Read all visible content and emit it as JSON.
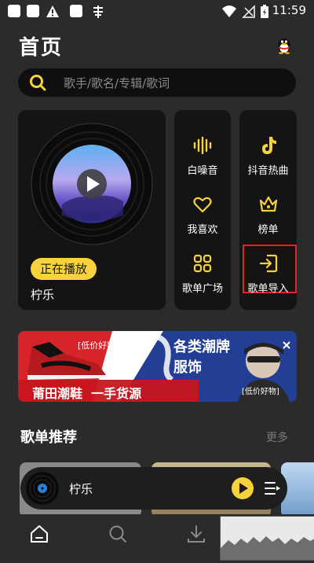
{
  "status_bar": {
    "time": "11:59"
  },
  "header": {
    "title": "首页",
    "avatar_icon": "qq-penguin-icon"
  },
  "search": {
    "placeholder": "歌手/歌名/专辑/歌词",
    "icon": "search-icon"
  },
  "now_playing": {
    "badge": "正在播放",
    "song": "柠乐"
  },
  "quick_tiles": [
    {
      "label": "白噪音",
      "icon": "soundwave-icon"
    },
    {
      "label": "抖音热曲",
      "icon": "tiktok-icon"
    },
    {
      "label": "我喜欢",
      "icon": "heart-icon"
    },
    {
      "label": "榜单",
      "icon": "crown-icon"
    },
    {
      "label": "歌单广场",
      "icon": "grid-icon"
    },
    {
      "label": "歌单导入",
      "icon": "import-icon"
    }
  ],
  "banner": {
    "tag_left": "[低价好物]",
    "title_left": "莆田潮鞋  一手货源",
    "title_right_1": "各类潮牌",
    "title_right_2": "服饰",
    "tag_right": "[低价好物]"
  },
  "section": {
    "title": "歌单推荐",
    "more": "更多"
  },
  "mini_player": {
    "song": "柠乐"
  },
  "tabs": [
    "home-icon",
    "search-icon",
    "download-icon"
  ],
  "colors": {
    "accent": "#f7d23c",
    "background": "#2b2b2b",
    "card": "#141414",
    "highlight": "#e0242b"
  }
}
